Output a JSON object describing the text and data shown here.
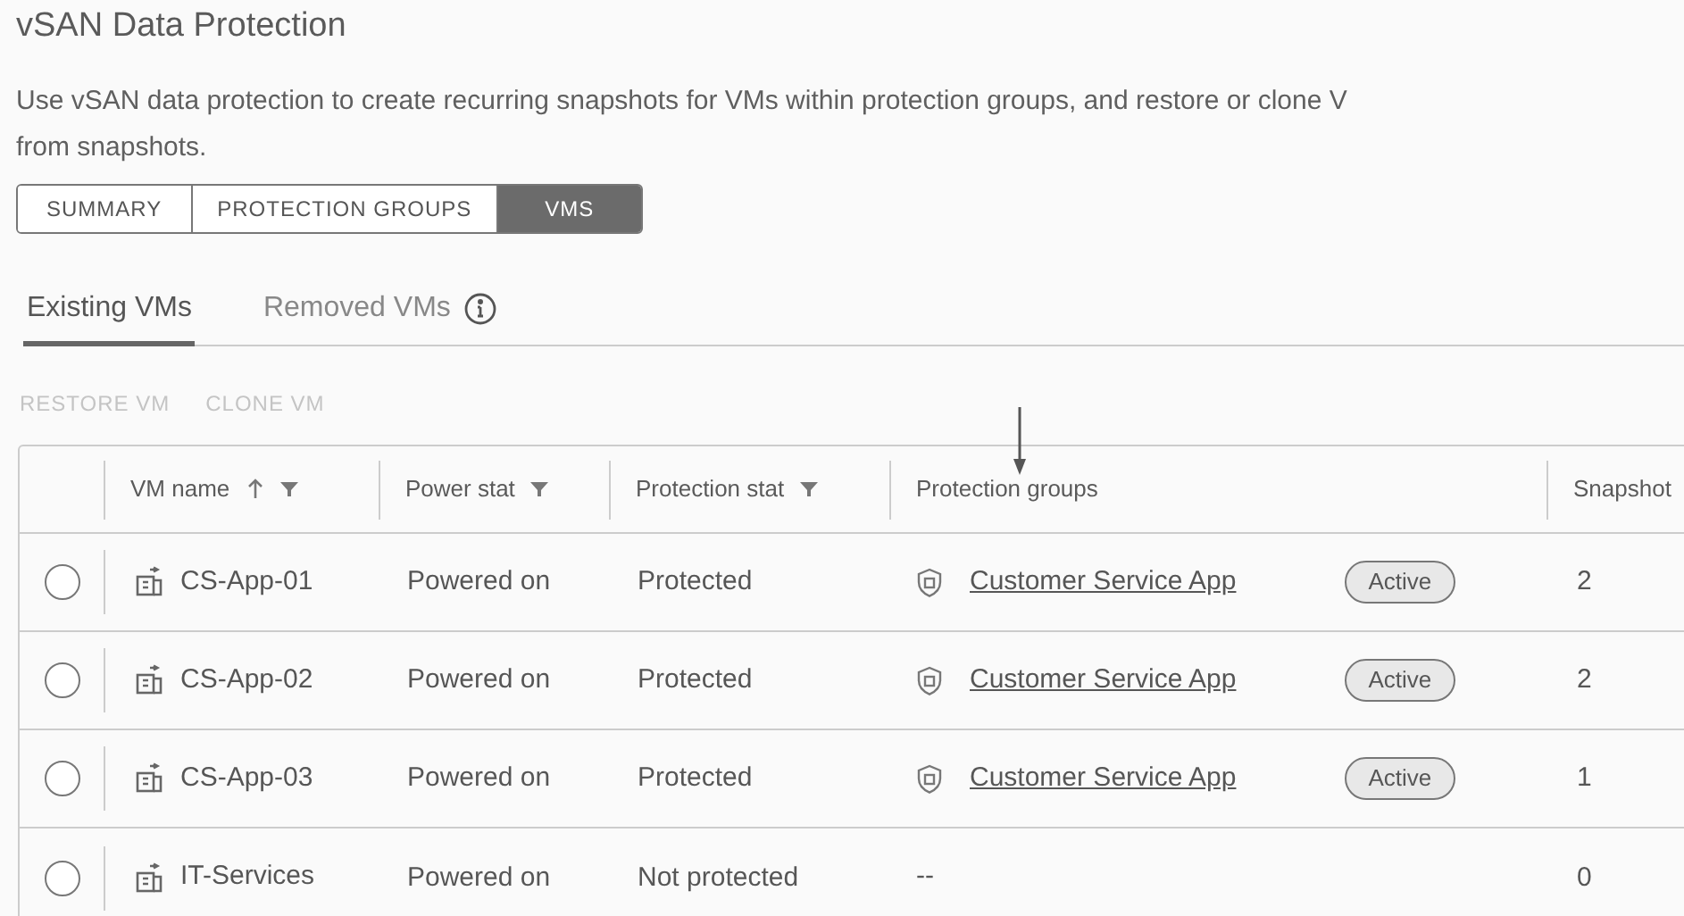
{
  "title": "vSAN Data Protection",
  "description_lines": [
    "Use vSAN data protection to create recurring snapshots for VMs within protection groups, and restore or clone V",
    "from snapshots."
  ],
  "tabs": [
    {
      "label": "SUMMARY",
      "selected": false
    },
    {
      "label": "PROTECTION GROUPS",
      "selected": false
    },
    {
      "label": "VMS",
      "selected": true
    }
  ],
  "subtabs": [
    {
      "label": "Existing VMs",
      "selected": true,
      "info": false
    },
    {
      "label": "Removed VMs",
      "selected": false,
      "info": true
    }
  ],
  "actions": [
    {
      "label": "RESTORE VM",
      "disabled": true
    },
    {
      "label": "CLONE VM",
      "disabled": true
    }
  ],
  "table": {
    "columns": [
      {
        "label": "VM name",
        "sorted_ascending": true,
        "filter": true
      },
      {
        "label": "Power stat",
        "sorted_ascending": false,
        "filter": true
      },
      {
        "label": "Protection stat",
        "sorted_ascending": false,
        "filter": true
      },
      {
        "label": "Protection groups",
        "sorted_ascending": false,
        "filter": false
      },
      {
        "label": "Snapshot",
        "sorted_ascending": false,
        "filter": false
      }
    ],
    "rows": [
      {
        "selected": false,
        "vm_name": "CS-App-01",
        "power_state": "Powered on",
        "protection_state": "Protected",
        "group": {
          "kind": "link",
          "name": "Customer Service App",
          "status": "Active"
        },
        "snapshots": "2"
      },
      {
        "selected": false,
        "vm_name": "CS-App-02",
        "power_state": "Powered on",
        "protection_state": "Protected",
        "group": {
          "kind": "link",
          "name": "Customer Service App",
          "status": "Active"
        },
        "snapshots": "2"
      },
      {
        "selected": false,
        "vm_name": "CS-App-03",
        "power_state": "Powered on",
        "protection_state": "Protected",
        "group": {
          "kind": "link",
          "name": "Customer Service App",
          "status": "Active"
        },
        "snapshots": "1"
      },
      {
        "selected": false,
        "vm_name": "IT-Services",
        "power_state": "Powered on",
        "protection_state": "Not protected",
        "group": {
          "kind": "none",
          "name": "--"
        },
        "snapshots": "0"
      }
    ]
  }
}
